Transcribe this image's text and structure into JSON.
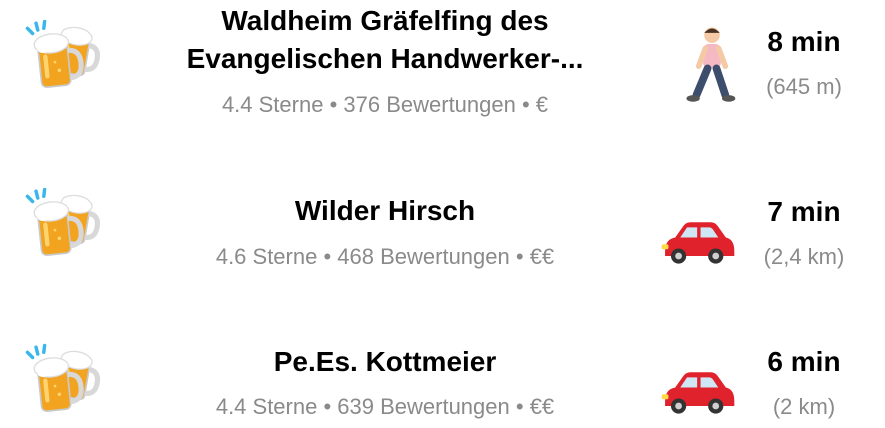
{
  "results": [
    {
      "title_line1": "Waldheim Gräfelfing des",
      "title_line2": "Evangelischen Handwerker-...",
      "rating": "4.4 Sterne",
      "reviews": "376 Bewertungen",
      "price": "€",
      "icon": "beer-mugs-icon",
      "transport_icon": "walking-person-icon",
      "time": "8 min",
      "distance": "(645 m)"
    },
    {
      "title": "Wilder Hirsch",
      "rating": "4.6 Sterne",
      "reviews": "468 Bewertungen",
      "price": "€€",
      "icon": "beer-mugs-icon",
      "transport_icon": "car-icon",
      "time": "7 min",
      "distance": "(2,4 km)"
    },
    {
      "title": "Pe.Es. Kottmeier",
      "rating": "4.4 Sterne",
      "reviews": "639 Bewertungen",
      "price": "€€",
      "icon": "beer-mugs-icon",
      "transport_icon": "car-icon",
      "time": "6 min",
      "distance": "(2 km)"
    }
  ],
  "separator": " • ",
  "colors": {
    "secondary_text": "#8a8a8a",
    "beer": "#f2a320",
    "foam": "#ffffff",
    "car": "#e0222c",
    "splash": "#3bb6ea"
  }
}
